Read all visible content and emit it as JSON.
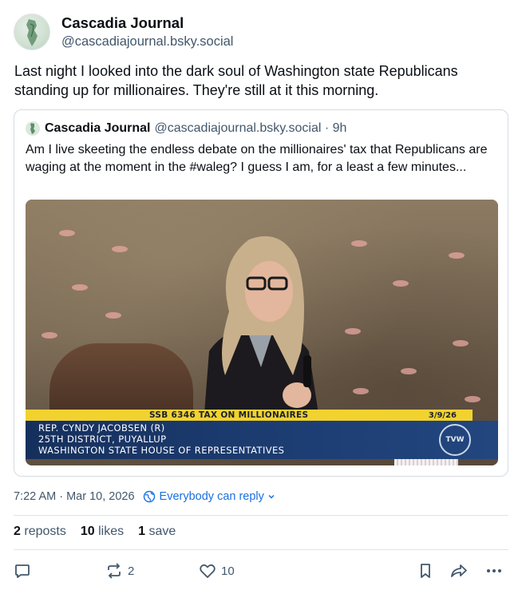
{
  "post": {
    "display_name": "Cascadia Journal",
    "handle": "@cascadiajournal.bsky.social",
    "text": "Last night I looked into the dark soul of Washington state Republicans standing up for millionaires. They're still at it this morning."
  },
  "quote": {
    "display_name": "Cascadia Journal",
    "handle_time": "@cascadiajournal.bsky.social · 9h",
    "text": "Am I live skeeting the endless debate on the millionaires' tax that Republicans are waging at the moment in the #waleg? I guess I am, for a least a few minutes...",
    "video": {
      "lower_third_title": "SSB 6346 TAX ON MILLIONAIRES",
      "lower_third_date": "3/9/26",
      "speaker_line1": "REP. CYNDY JACOBSEN (R)",
      "speaker_line2": "25TH DISTRICT, PUYALLUP",
      "speaker_line3": "WASHINGTON STATE HOUSE OF REPRESENTATIVES",
      "network_logo": "TVW"
    }
  },
  "meta": {
    "timestamp": "7:22 AM · Mar 10, 2026",
    "reply_setting": "Everybody can reply"
  },
  "stats": {
    "reposts_count": "2",
    "reposts_label": "reposts",
    "likes_count": "10",
    "likes_label": "likes",
    "saves_count": "1",
    "saves_label": "save"
  },
  "actions": {
    "repost_count": "2",
    "like_count": "10"
  },
  "icons": [
    "reply-icon",
    "repost-icon",
    "like-icon",
    "bookmark-icon",
    "share-icon",
    "more-icon",
    "globe-icon",
    "chevron-down-icon"
  ],
  "colors": {
    "accent": "#1a6fe0",
    "text": "#0b0f14",
    "muted": "#42576c",
    "border": "#d4dbe2"
  }
}
